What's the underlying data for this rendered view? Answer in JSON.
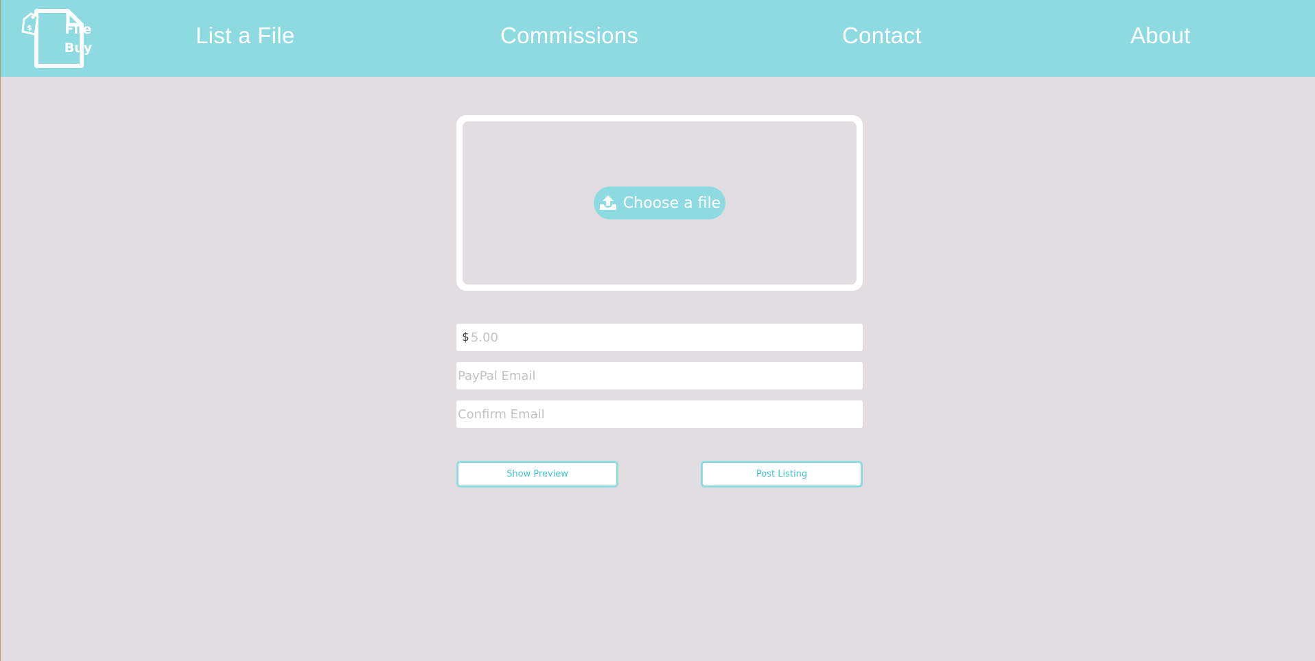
{
  "brand": {
    "logo_line1": "File",
    "logo_line2": "Buy",
    "tag_symbol": "$",
    "color_primary": "#8ddbe0",
    "color_background": "#e2dde0"
  },
  "nav": {
    "items": [
      {
        "label": "List a File"
      },
      {
        "label": "Commissions"
      },
      {
        "label": "Contact"
      },
      {
        "label": "About"
      }
    ]
  },
  "upload": {
    "button_label": "Choose a file",
    "icon": "upload-tray-icon"
  },
  "form": {
    "price": {
      "currency_symbol": "$",
      "placeholder": "5.00",
      "value": ""
    },
    "paypal_email": {
      "placeholder": "PayPal Email",
      "value": ""
    },
    "confirm_email": {
      "placeholder": "Confirm Email",
      "value": ""
    }
  },
  "actions": {
    "show_preview_label": "Show Preview",
    "post_listing_label": "Post Listing"
  }
}
